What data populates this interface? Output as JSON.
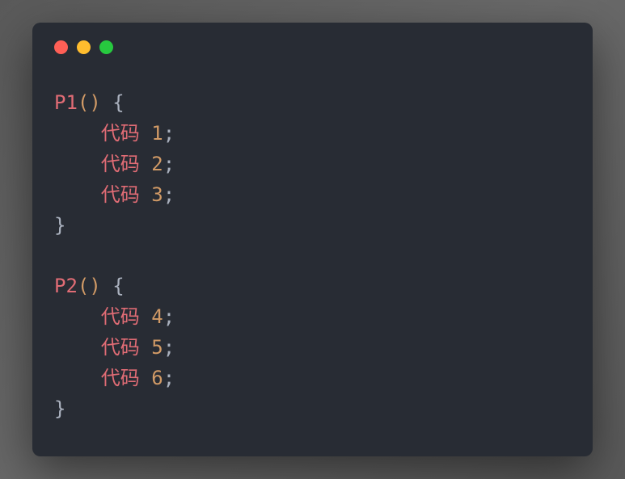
{
  "functions": [
    {
      "name": "P1",
      "lines": [
        {
          "kw": "代码",
          "num": "1"
        },
        {
          "kw": "代码",
          "num": "2"
        },
        {
          "kw": "代码",
          "num": "3"
        }
      ]
    },
    {
      "name": "P2",
      "lines": [
        {
          "kw": "代码",
          "num": "4"
        },
        {
          "kw": "代码",
          "num": "5"
        },
        {
          "kw": "代码",
          "num": "6"
        }
      ]
    }
  ],
  "tokens": {
    "open_paren": "(",
    "close_paren": ")",
    "open_brace": "{",
    "close_brace": "}",
    "semicolon": ";",
    "space": " "
  }
}
